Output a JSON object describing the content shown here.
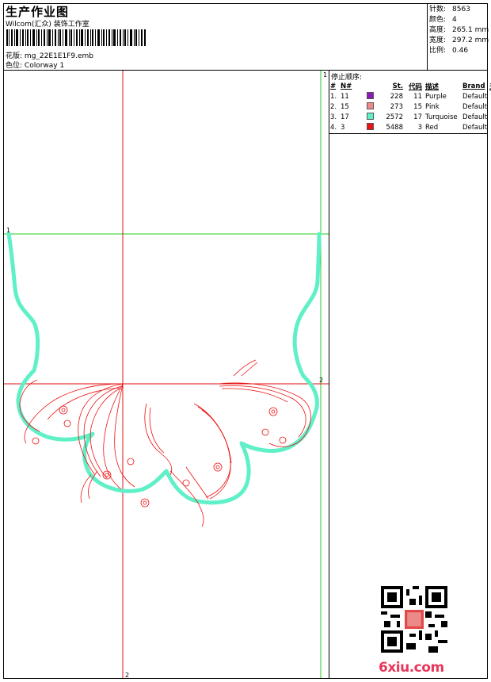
{
  "header": {
    "title": "生产作业图",
    "company": "Wilcom(汇众) 装饰工作室",
    "design_label": "花版:",
    "design_file": "mg_22E1E1F9.emb",
    "colorway_label": "色位:",
    "colorway": "Colorway 1"
  },
  "stats": [
    {
      "label": "针数:",
      "value": "8563"
    },
    {
      "label": "颜色:",
      "value": "4"
    },
    {
      "label": "高度:",
      "value": "265.1 mm"
    },
    {
      "label": "宽度:",
      "value": "297.2 mm"
    },
    {
      "label": "比例:",
      "value": "0.46"
    }
  ],
  "stop_sequence": {
    "title": "停止顺序:",
    "headers": [
      "#",
      "N#",
      "St.",
      "代码",
      "描述",
      "Brand",
      "元素"
    ],
    "rows": [
      {
        "index": "1.",
        "needle": "11",
        "stitches": "228",
        "code": "11",
        "desc": "Purple",
        "brand": "Default",
        "color": "#8a1ab8"
      },
      {
        "index": "2.",
        "needle": "15",
        "stitches": "273",
        "code": "15",
        "desc": "Pink",
        "brand": "Default",
        "color": "#f08a8a"
      },
      {
        "index": "3.",
        "needle": "17",
        "stitches": "2572",
        "code": "17",
        "desc": "Turquoise",
        "brand": "Default",
        "color": "#5ff0c8"
      },
      {
        "index": "4.",
        "needle": "3",
        "stitches": "5488",
        "code": "3",
        "desc": "Red",
        "brand": "Default",
        "color": "#ee1111"
      }
    ]
  },
  "guides": {
    "h1": "1",
    "h2": "2",
    "v1": "1",
    "v2": "2"
  },
  "watermark": "6xiu.com",
  "colors": {
    "guide_green": "#22cc22",
    "guide_red": "#dd1111",
    "outline": "#5ff0c8",
    "stitch": "#ee1111"
  }
}
